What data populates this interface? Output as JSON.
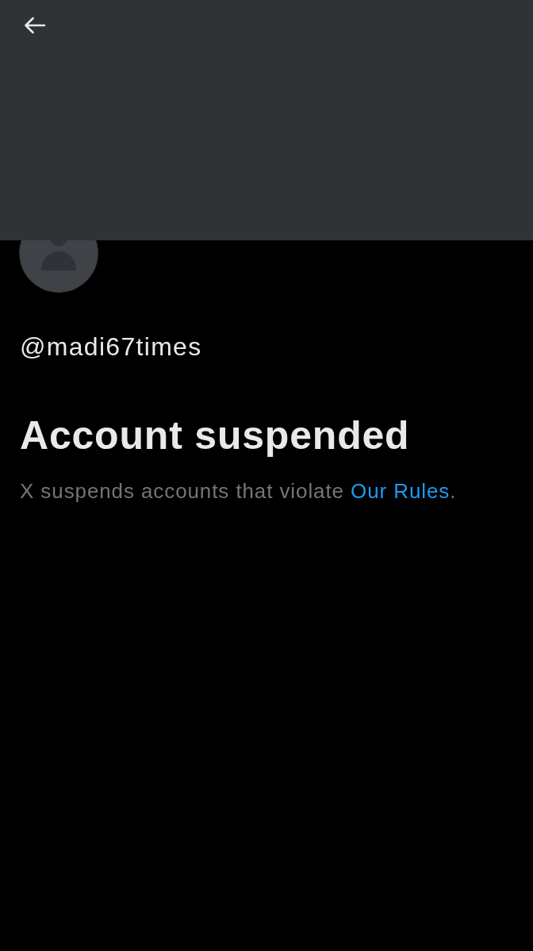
{
  "profile": {
    "handle": "@madi67times"
  },
  "notice": {
    "title": "Account suspended",
    "message": "X suspends accounts that violate",
    "link": "Our Rules",
    "link_suffix": "."
  }
}
